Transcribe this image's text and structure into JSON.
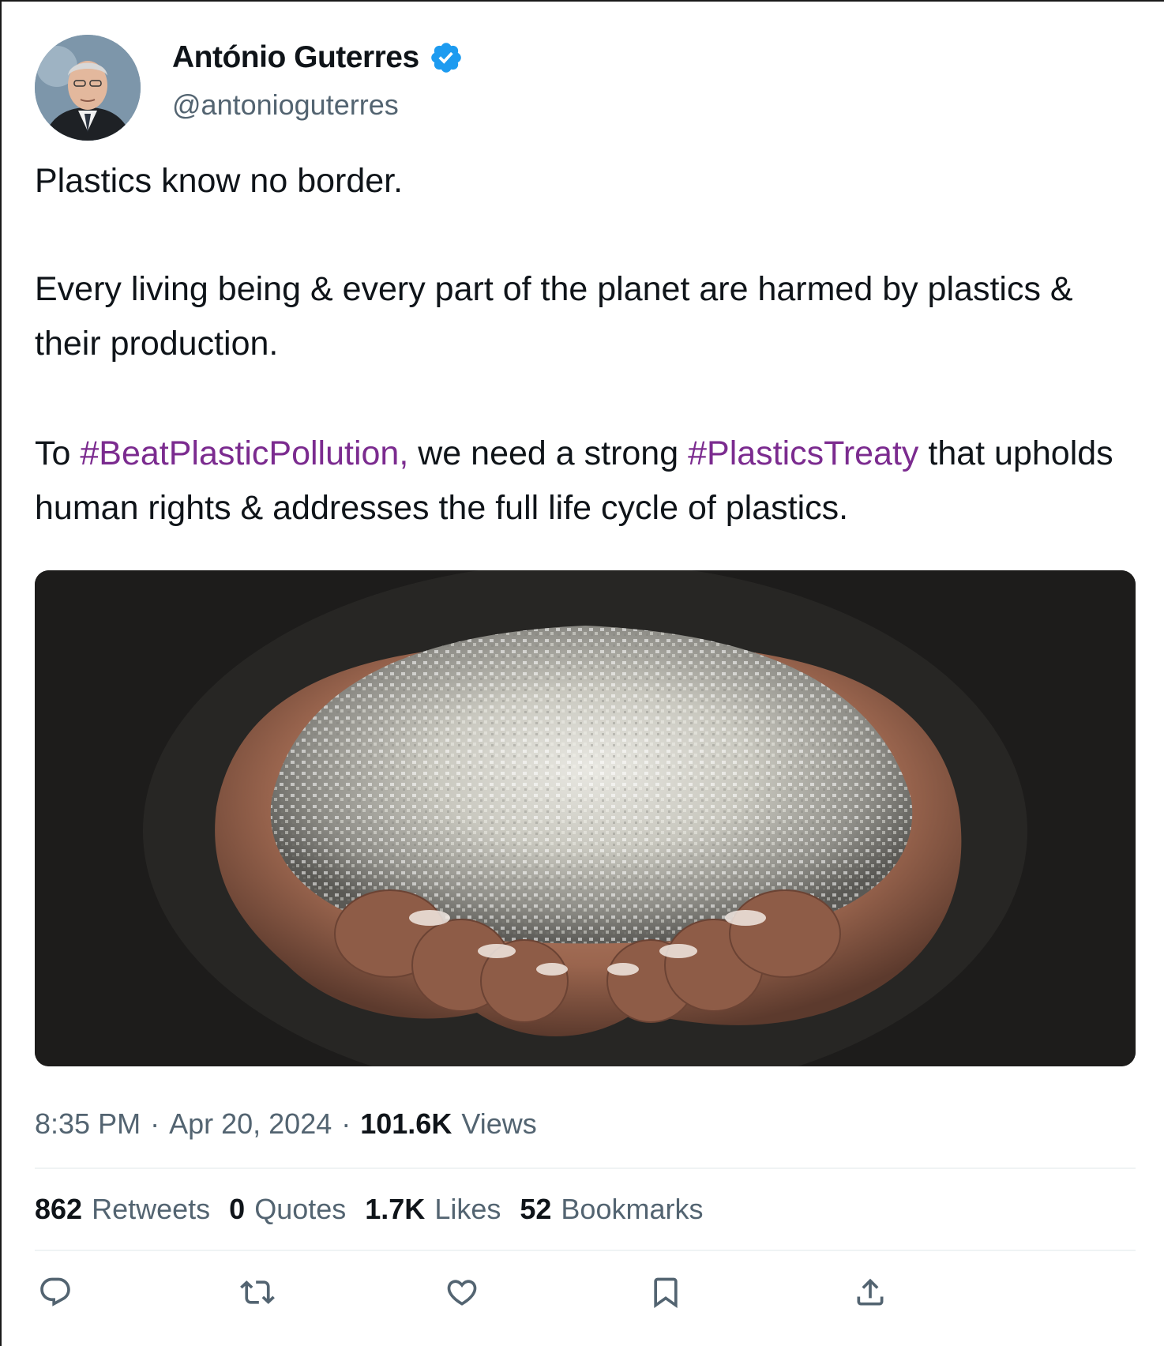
{
  "author": {
    "name": "António Guterres",
    "handle": "@antonioguterres",
    "verified": true,
    "verified_color": "#1d9bf0",
    "avatar_icon": "profile-photo"
  },
  "tweet": {
    "paragraph1": "Plastics know no border.",
    "paragraph2": "Every living being & every part of the planet are harmed by plastics & their production.",
    "paragraph3": {
      "before": "To ",
      "hashtag1": "#BeatPlasticPollution,",
      "middle": " we need a strong ",
      "hashtag2": "#PlasticsTreaty",
      "after": " that upholds human rights & addresses the full life cycle of plastics."
    },
    "hashtag_color": "#7b2b8f"
  },
  "media": {
    "description_icon": "photo-hands-holding-plastic-pellets"
  },
  "meta": {
    "time": "8:35 PM",
    "dot1": "·",
    "date": "Apr 20, 2024",
    "dot2": "·",
    "views_count": "101.6K",
    "views_label": "Views"
  },
  "stats": {
    "retweets_count": "862",
    "retweets_label": "Retweets",
    "quotes_count": "0",
    "quotes_label": "Quotes",
    "likes_count": "1.7K",
    "likes_label": "Likes",
    "bookmarks_count": "52",
    "bookmarks_label": "Bookmarks"
  },
  "actions": [
    {
      "icon": "reply-icon"
    },
    {
      "icon": "retweet-icon"
    },
    {
      "icon": "like-icon"
    },
    {
      "icon": "bookmark-icon"
    },
    {
      "icon": "share-icon"
    }
  ],
  "colors": {
    "text_primary": "#0f1419",
    "text_secondary": "#536471",
    "divider": "#eff3f4"
  }
}
